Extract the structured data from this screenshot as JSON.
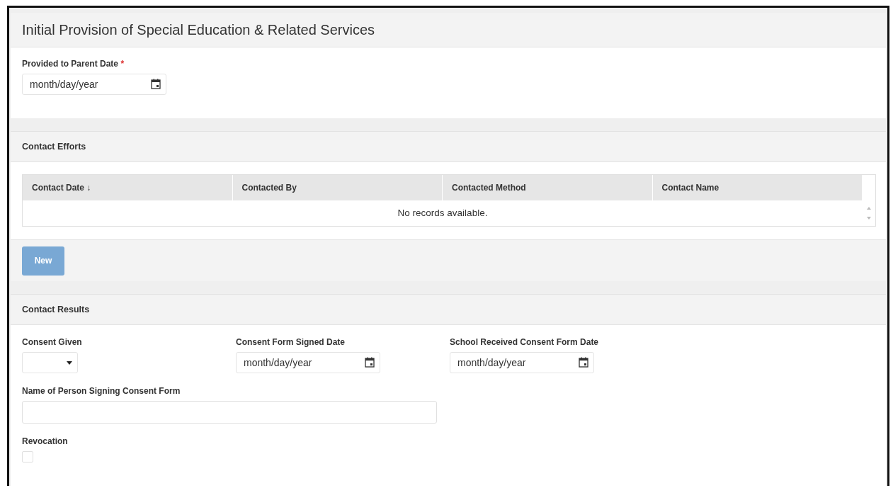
{
  "title": "Initial Provision of Special Education & Related Services",
  "provided_date": {
    "label": "Provided to Parent Date",
    "required_mark": "*",
    "placeholder": "month/day/year"
  },
  "contact_efforts": {
    "heading": "Contact Efforts",
    "table": {
      "columns": [
        {
          "label": "Contact Date ↓"
        },
        {
          "label": "Contacted By"
        },
        {
          "label": "Contacted Method"
        },
        {
          "label": "Contact Name"
        }
      ],
      "empty_message": "No records available."
    },
    "new_button": {
      "label": "New",
      "disabled": true
    }
  },
  "contact_results": {
    "heading": "Contact Results",
    "consent_given": {
      "label": "Consent Given"
    },
    "date_fields": [
      {
        "label": "Consent Form Signed Date",
        "placeholder": "month/day/year"
      },
      {
        "label": "School Received Consent Form Date",
        "placeholder": "month/day/year"
      }
    ],
    "name_field": {
      "label": "Name of Person Signing Consent Form"
    },
    "revocation": {
      "label": "Revocation",
      "checked": false
    }
  }
}
